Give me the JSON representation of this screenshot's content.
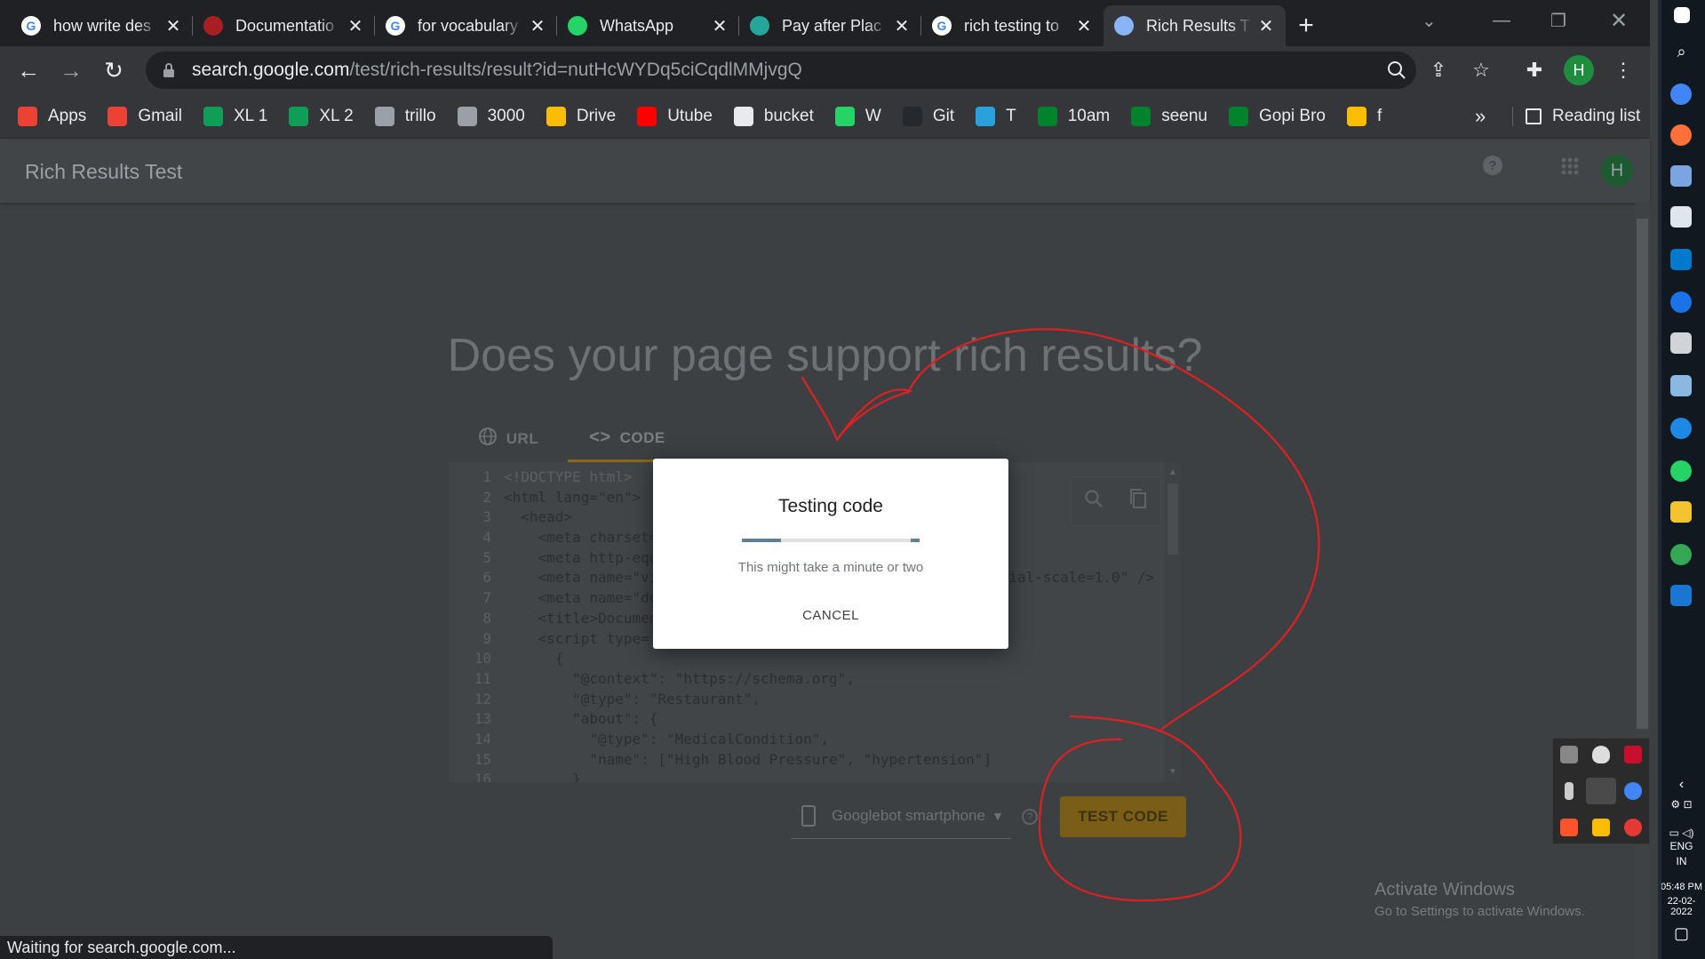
{
  "tabs": [
    {
      "title": "how write des",
      "icon": "google-icon",
      "color": "#ffffff"
    },
    {
      "title": "Documentatio",
      "icon": "schema-org-icon",
      "color": "#a91e22"
    },
    {
      "title": "for vocabulary",
      "icon": "google-icon",
      "color": "#ffffff"
    },
    {
      "title": "WhatsApp",
      "icon": "whatsapp-icon",
      "color": "#25d366"
    },
    {
      "title": "Pay after Plac",
      "icon": "feather-icon",
      "color": "#26a69a"
    },
    {
      "title": "rich testing to",
      "icon": "google-icon",
      "color": "#ffffff"
    },
    {
      "title": "Rich Results T",
      "icon": "rich-results-icon",
      "color": "#8ab4f8"
    }
  ],
  "url": {
    "host": "search.google.com",
    "path": "/test/rich-results/result?id=nutHcWYDq5ciCqdlMMjvgQ"
  },
  "profile_initial": "H",
  "bookmarks": [
    {
      "label": "Apps",
      "icon": "apps-grid-icon",
      "color": "#ea4335"
    },
    {
      "label": "Gmail",
      "icon": "gmail-icon",
      "color": "#ea4335"
    },
    {
      "label": "XL 1",
      "icon": "sheets-icon",
      "color": "#0f9d58"
    },
    {
      "label": "XL 2",
      "icon": "sheets-icon",
      "color": "#0f9d58"
    },
    {
      "label": "trillo",
      "icon": "trello-icon",
      "color": "#9aa0a6"
    },
    {
      "label": "3000",
      "icon": "localhost-icon",
      "color": "#9aa0a6"
    },
    {
      "label": "Drive",
      "icon": "drive-icon",
      "color": "#fbbc04"
    },
    {
      "label": "Utube",
      "icon": "youtube-icon",
      "color": "#ff0000"
    },
    {
      "label": "bucket",
      "icon": "globe-icon",
      "color": "#e8eaed"
    },
    {
      "label": "W",
      "icon": "whatsapp-icon",
      "color": "#25d366"
    },
    {
      "label": "Git",
      "icon": "github-icon",
      "color": "#24292e"
    },
    {
      "label": "T",
      "icon": "telegram-icon",
      "color": "#2aa1da"
    },
    {
      "label": "10am",
      "icon": "meet-icon",
      "color": "#00832d"
    },
    {
      "label": "seenu",
      "icon": "meet-icon",
      "color": "#00832d"
    },
    {
      "label": "Gopi Bro",
      "icon": "meet-icon",
      "color": "#00832d"
    },
    {
      "label": "f",
      "icon": "keep-icon",
      "color": "#fbbc04"
    }
  ],
  "more_bookmarks": "»",
  "reading_list": "Reading list",
  "app": {
    "title": "Rich Results Test",
    "avatar_initial": "H",
    "headline": "Does your page support rich results?",
    "mode_tabs": [
      {
        "label": "URL",
        "icon": "globe-icon"
      },
      {
        "label": "CODE",
        "icon": "code-brackets-icon"
      }
    ],
    "code_lines": [
      "<!DOCTYPE html>",
      "<html lang=\"en\">",
      "  <head>",
      "    <meta charset=",
      "    <meta http-equ",
      "    <meta name=\"vi                                         ial-scale=1.0\" />",
      "    <meta name=\"de                                        >",
      "    <title>Documen",
      "    <script type=",
      "      {",
      "        \"@context\": \"https://schema.org\",",
      "        \"@type\": \"Restaurant\",",
      "        \"about\": {",
      "          \"@type\": \"MedicalCondition\",",
      "          \"name\": [\"High Blood Pressure\", \"hypertension\"]",
      "        }"
    ],
    "device": "Googlebot smartphone",
    "test_button": "TEST CODE"
  },
  "dialog": {
    "title": "Testing code",
    "subtitle": "This might take a minute or two",
    "cancel": "CANCEL",
    "progress": 0.22
  },
  "activate": {
    "line1": "Activate Windows",
    "line2": "Go to Settings to activate Windows."
  },
  "status": "Waiting for search.google.com...",
  "taskbar": {
    "lang1": "ENG",
    "lang2": "IN",
    "time": "05:48 PM",
    "date": "22-02-2022"
  },
  "annotation_color": "#e02020"
}
